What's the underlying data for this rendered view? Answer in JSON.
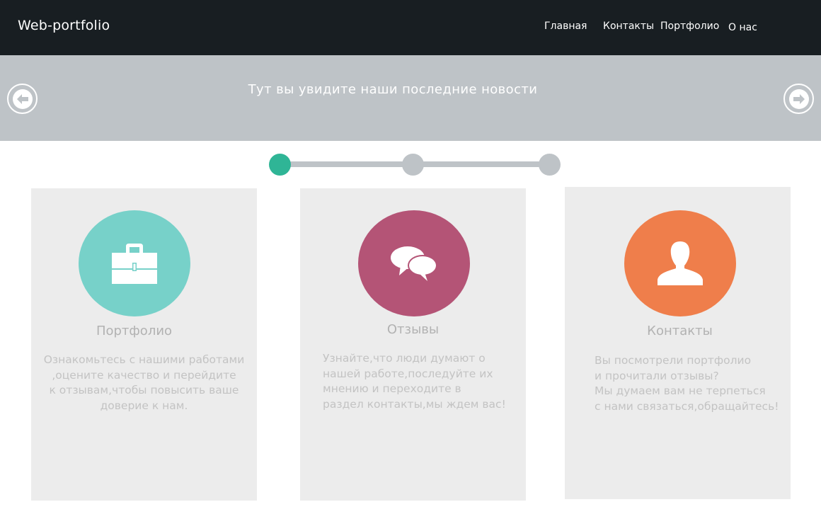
{
  "header": {
    "logo": "Web-portfolio",
    "nav": {
      "home": "Главная",
      "contacts": "Контакты",
      "portfolio": "Портфолио",
      "about": "О нас"
    }
  },
  "banner": {
    "text": "Тут вы увидите наши последние новости",
    "left_icon": "arrow-left-icon",
    "right_icon": "arrow-right-icon"
  },
  "progress": {
    "steps": 3,
    "active_step": 1
  },
  "cards": [
    {
      "title": "Портфолио",
      "icon": "briefcase-icon",
      "color": "#77d1c9",
      "text": "Ознакомьтесь с нашими работами\n,оцените качество и перейдите\nк отзывам,чтобы повысить ваше\nдоверие к нам."
    },
    {
      "title": "Отзывы",
      "icon": "speech-bubbles-icon",
      "color": "#b45476",
      "text": "Узнайте,что люди думают о\nнашей работе,последуйте их\nмнению и переходите в\nраздел контакты,мы ждем вас!"
    },
    {
      "title": "Контакты",
      "icon": "user-icon",
      "color": "#ef7e4b",
      "text": "Вы посмотрели портфолио\nи прочитали отзывы?\nМы думаем вам не терпеться\nс нами связаться,обращайтесь!"
    }
  ],
  "colors": {
    "header_bg": "#181e22",
    "banner_bg": "#bec3c7",
    "active_dot": "#2fb596",
    "card_bg": "#ececec"
  }
}
